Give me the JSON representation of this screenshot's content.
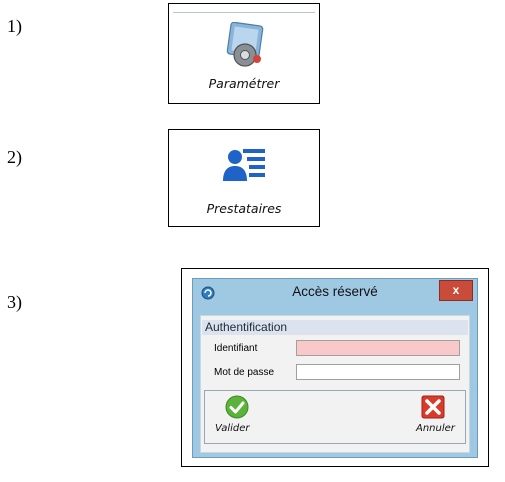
{
  "steps": {
    "one": "1)",
    "two": "2)",
    "three": "3)"
  },
  "toolbar": {
    "configure_label": "Paramétrer",
    "providers_label": "Prestataires"
  },
  "dialog": {
    "title": "Accès réservé",
    "close_label": "x",
    "section_title": "Authentification",
    "username_label": "Identifiant",
    "username_value": "",
    "password_label": "Mot de passe",
    "password_value": "",
    "validate_label": "Valider",
    "cancel_label": "Annuler"
  },
  "colors": {
    "username_field_bg": "#f9c9c9",
    "dialog_frame": "#9fc8e2",
    "close_button": "#c94b3a",
    "validate_icon": "#5cb33a",
    "cancel_icon": "#d93a2a"
  },
  "icons": {
    "configure": "settings-gear-icon",
    "providers": "contacts-list-icon",
    "dialog_app": "app-logo-icon",
    "validate": "checkmark-icon",
    "cancel": "cross-icon"
  }
}
